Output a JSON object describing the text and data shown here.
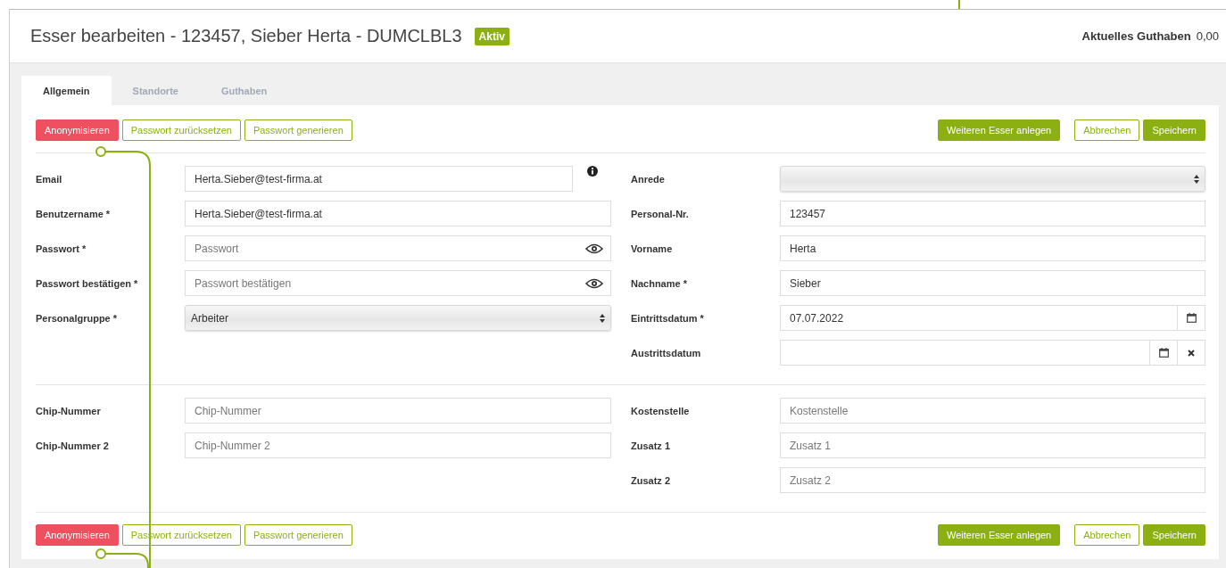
{
  "header": {
    "title": "Esser bearbeiten - 123457, Sieber Herta - DUMCLBL3",
    "status": "Aktiv",
    "balance_label": "Aktuelles Guthaben",
    "balance_value": "0,00"
  },
  "tabs": [
    {
      "label": "Allgemein",
      "selected": true
    },
    {
      "label": "Standorte",
      "selected": false
    },
    {
      "label": "Guthaben",
      "selected": false
    }
  ],
  "toolbar_top": {
    "left_buttons": [
      {
        "label": "Anonymisieren",
        "kind": "danger"
      },
      {
        "label": "Passwort zurücksetzen",
        "kind": "outline"
      },
      {
        "label": "Passwort generieren",
        "kind": "outline"
      }
    ],
    "right_buttons": [
      {
        "label": "Weiteren Esser anlegen",
        "kind": "primary"
      },
      {
        "label": "Abbrechen",
        "kind": "outline"
      },
      {
        "label": "Speichern",
        "kind": "primary"
      }
    ]
  },
  "sections": [
    {
      "left_fields": [
        {
          "label": "Email",
          "kind": "text",
          "value": "Herta.Sieber@test-firma.at",
          "info": true
        },
        {
          "label": "Benutzername *",
          "kind": "text",
          "value": "Herta.Sieber@test-firma.at"
        },
        {
          "label": "Passwort *",
          "kind": "password",
          "placeholder": "Passwort"
        },
        {
          "label": "Passwort bestätigen *",
          "kind": "password",
          "placeholder": "Passwort bestätigen"
        },
        {
          "label": "Personalgruppe *",
          "kind": "select",
          "value": "Arbeiter"
        }
      ],
      "right_fields": [
        {
          "label": "Anrede",
          "kind": "select"
        },
        {
          "label": "Personal-Nr.",
          "kind": "text",
          "value": "123457"
        },
        {
          "label": "Vorname",
          "kind": "text",
          "value": "Herta"
        },
        {
          "label": "Nachname *",
          "kind": "text",
          "value": "Sieber"
        },
        {
          "label": "Eintrittsdatum *",
          "kind": "date",
          "value": "07.07.2022",
          "clearable": false
        },
        {
          "label": "Austrittsdatum",
          "kind": "date",
          "clearable": true
        }
      ]
    },
    {
      "left_fields": [
        {
          "label": "Chip-Nummer",
          "kind": "text",
          "placeholder": "Chip-Nummer"
        },
        {
          "label": "Chip-Nummer 2",
          "kind": "text",
          "placeholder": "Chip-Nummer 2"
        }
      ],
      "right_fields": [
        {
          "label": "Kostenstelle",
          "kind": "text",
          "placeholder": "Kostenstelle"
        },
        {
          "label": "Zusatz 1",
          "kind": "text",
          "placeholder": "Zusatz 1"
        },
        {
          "label": "Zusatz 2",
          "kind": "text",
          "placeholder": "Zusatz 2"
        }
      ]
    }
  ],
  "toolbar_bottom": {
    "left_buttons": [
      {
        "label": "Anonymisieren",
        "kind": "danger"
      },
      {
        "label": "Passwort zurücksetzen",
        "kind": "outline"
      },
      {
        "label": "Passwort generieren",
        "kind": "outline"
      }
    ],
    "right_buttons": [
      {
        "label": "Weiteren Esser anlegen",
        "kind": "primary"
      },
      {
        "label": "Abbrechen",
        "kind": "outline"
      },
      {
        "label": "Speichern",
        "kind": "primary"
      }
    ]
  }
}
